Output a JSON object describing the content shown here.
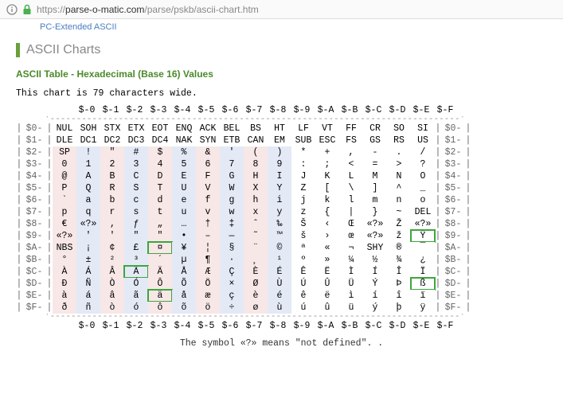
{
  "url": {
    "proto": "https://",
    "host": "parse-o-matic.com",
    "path": "/parse/pskb/ascii-chart.htm"
  },
  "breadcrumb": "PC-Extended ASCII",
  "page_title": "ASCII Charts",
  "subtitle": "ASCII Table - Hexadecimal (Base 16) Values",
  "width_note": "This chart is 79 characters wide.",
  "footer": "The symbol «?» means \"not defined\". .",
  "col_headers": [
    "$-0",
    "$-1",
    "$-2",
    "$-3",
    "$-4",
    "$-5",
    "$-6",
    "$-7",
    "$-8",
    "$-9",
    "$-A",
    "$-B",
    "$-C",
    "$-D",
    "$-E",
    "$-F"
  ],
  "row_labels": [
    "$0-",
    "$1-",
    "$2-",
    "$3-",
    "$4-",
    "$5-",
    "$6-",
    "$7-",
    "$8-",
    "$9-",
    "$A-",
    "$B-",
    "$C-",
    "$D-",
    "$E-",
    "$F-"
  ],
  "rows": [
    [
      "NUL",
      "SOH",
      "STX",
      "ETX",
      "EOT",
      "ENQ",
      "ACK",
      "BEL",
      "BS",
      "HT",
      "LF",
      "VT",
      "FF",
      "CR",
      "SO",
      "SI"
    ],
    [
      "DLE",
      "DC1",
      "DC2",
      "DC3",
      "DC4",
      "NAK",
      "SYN",
      "ETB",
      "CAN",
      "EM",
      "SUB",
      "ESC",
      "FS",
      "GS",
      "RS",
      "US"
    ],
    [
      "SP",
      "!",
      "\"",
      "#",
      "$",
      "%",
      "&",
      "'",
      "(",
      ")",
      "*",
      "+",
      ",",
      "-",
      ".",
      "/"
    ],
    [
      "0",
      "1",
      "2",
      "3",
      "4",
      "5",
      "6",
      "7",
      "8",
      "9",
      ":",
      ";",
      "<",
      "=",
      ">",
      "?"
    ],
    [
      "@",
      "A",
      "B",
      "C",
      "D",
      "E",
      "F",
      "G",
      "H",
      "I",
      "J",
      "K",
      "L",
      "M",
      "N",
      "O"
    ],
    [
      "P",
      "Q",
      "R",
      "S",
      "T",
      "U",
      "V",
      "W",
      "X",
      "Y",
      "Z",
      "[",
      "\\",
      "]",
      "^",
      "_"
    ],
    [
      "`",
      "a",
      "b",
      "c",
      "d",
      "e",
      "f",
      "g",
      "h",
      "i",
      "j",
      "k",
      "l",
      "m",
      "n",
      "o"
    ],
    [
      "p",
      "q",
      "r",
      "s",
      "t",
      "u",
      "v",
      "w",
      "x",
      "y",
      "z",
      "{",
      "|",
      "}",
      "~",
      "DEL"
    ],
    [
      "€",
      "«?»",
      "‚",
      "ƒ",
      "„",
      "…",
      "†",
      "‡",
      "ˆ",
      "‰",
      "Š",
      "‹",
      "Œ",
      "«?»",
      "Ž",
      "«?»"
    ],
    [
      "«?»",
      "'",
      "'",
      "\"",
      "\"",
      "•",
      "–",
      "—",
      "˜",
      "™",
      "š",
      "›",
      "œ",
      "«?»",
      "ž",
      "Ÿ"
    ],
    [
      "NBS",
      "¡",
      "¢",
      "£",
      "¤",
      "¥",
      "¦",
      "§",
      "¨",
      "©",
      "ª",
      "«",
      "¬",
      "SHY",
      "®",
      "¯"
    ],
    [
      "°",
      "±",
      "²",
      "³",
      "´",
      "µ",
      "¶",
      "·",
      "¸",
      "¹",
      "º",
      "»",
      "¼",
      "½",
      "¾",
      "¿"
    ],
    [
      "À",
      "Á",
      "Â",
      "Ã",
      "Ä",
      "Å",
      "Æ",
      "Ç",
      "È",
      "É",
      "Ê",
      "Ë",
      "Ì",
      "Í",
      "Î",
      "Ï"
    ],
    [
      "Ð",
      "Ñ",
      "Ò",
      "Ó",
      "Ô",
      "Õ",
      "Ö",
      "×",
      "Ø",
      "Ù",
      "Ú",
      "Û",
      "Ü",
      "Ý",
      "Þ",
      "ß"
    ],
    [
      "à",
      "á",
      "â",
      "ã",
      "ä",
      "å",
      "æ",
      "ç",
      "è",
      "é",
      "ê",
      "ë",
      "ì",
      "í",
      "î",
      "ï"
    ],
    [
      "ð",
      "ñ",
      "ò",
      "ó",
      "ô",
      "õ",
      "ö",
      "÷",
      "ø",
      "ù",
      "ú",
      "û",
      "ü",
      "ý",
      "þ",
      "ÿ"
    ]
  ],
  "highlights": [
    [
      9,
      15
    ],
    [
      10,
      4
    ],
    [
      12,
      3
    ],
    [
      13,
      15
    ],
    [
      14,
      4
    ]
  ],
  "colorize_start_row": 2,
  "color_pattern": [
    "c-pink",
    "c-blue",
    "c-pink",
    "c-blue",
    "c-pink",
    "c-blue",
    "c-pink",
    "c-blue",
    "c-pink",
    "c-blue",
    "c-none",
    "c-none",
    "c-none",
    "c-none",
    "c-none",
    "c-none"
  ]
}
